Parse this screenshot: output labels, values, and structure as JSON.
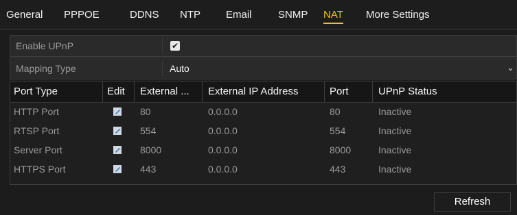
{
  "tabs": [
    {
      "label": "General"
    },
    {
      "label": "PPPOE"
    },
    {
      "label": "DDNS"
    },
    {
      "label": "NTP"
    },
    {
      "label": "Email"
    },
    {
      "label": "SNMP"
    },
    {
      "label": "NAT"
    },
    {
      "label": "More Settings"
    }
  ],
  "active_tab": "NAT",
  "upnp": {
    "label": "Enable UPnP",
    "checked": true,
    "check_glyph": "✔"
  },
  "mapping": {
    "label": "Mapping Type",
    "value": "Auto",
    "caret": "⌄"
  },
  "table": {
    "headers": [
      "Port Type",
      "Edit",
      "External ...",
      "External IP Address",
      "Port",
      "UPnP Status"
    ],
    "rows": [
      {
        "port_type": "HTTP Port",
        "external": "80",
        "ip": "0.0.0.0",
        "port": "80",
        "status": "Inactive"
      },
      {
        "port_type": "RTSP Port",
        "external": "554",
        "ip": "0.0.0.0",
        "port": "554",
        "status": "Inactive"
      },
      {
        "port_type": "Server Port",
        "external": "8000",
        "ip": "0.0.0.0",
        "port": "8000",
        "status": "Inactive"
      },
      {
        "port_type": "HTTPS Port",
        "external": "443",
        "ip": "0.0.0.0",
        "port": "443",
        "status": "Inactive"
      }
    ]
  },
  "refresh_label": "Refresh",
  "colors": {
    "accent": "#f1c40f",
    "background": "#1c1c1c",
    "muted_text": "#9a9a9a"
  },
  "icons": {
    "edit": "edit-pencil-icon",
    "checkbox": "checkmark-icon",
    "caret": "chevron-down-icon"
  }
}
